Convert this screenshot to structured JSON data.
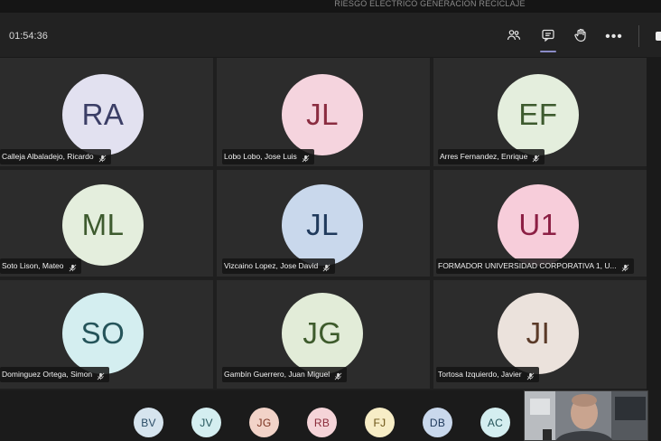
{
  "meeting": {
    "title": "RIESGO ELÉCTRICO GENERACIÓN RECICLAJE",
    "timer": "01:54:36"
  },
  "toolbar": {
    "buttons": [
      {
        "name": "participants-icon"
      },
      {
        "name": "chat-icon",
        "active": true
      },
      {
        "name": "raise-hand-icon"
      },
      {
        "name": "more-options-icon",
        "label": "•••"
      }
    ]
  },
  "participants": [
    {
      "initials": "RA",
      "name": "Calleja Albaladejo, Ricardo",
      "bg": "#e2e1f0",
      "fg": "#3b3e66"
    },
    {
      "initials": "JL",
      "name": "Lobo Lobo, Jose Luis",
      "bg": "#f5d4de",
      "fg": "#8a2c40"
    },
    {
      "initials": "EF",
      "name": "Arres Fernandez, Enrique",
      "bg": "#e4eedd",
      "fg": "#3d5a2e"
    },
    {
      "initials": "ML",
      "name": "Soto Lison, Mateo",
      "bg": "#e4eedd",
      "fg": "#3d5a2e"
    },
    {
      "initials": "JL",
      "name": "Vizcaino Lopez, Jose David",
      "bg": "#c9d8ec",
      "fg": "#203a5c"
    },
    {
      "initials": "U1",
      "name": "FORMADOR UNIVERSIDAD CORPORATIVA 1, U...",
      "bg": "#f7cdda",
      "fg": "#8c1f44"
    },
    {
      "initials": "SO",
      "name": "Dominguez Ortega, Simon",
      "bg": "#d4eef0",
      "fg": "#25545a"
    },
    {
      "initials": "JG",
      "name": "Gambín Guerrero, Juan Miguel",
      "bg": "#e2ecd8",
      "fg": "#3e5b2c"
    },
    {
      "initials": "JI",
      "name": "Tortosa Izquierdo, Javier",
      "bg": "#ebe2dc",
      "fg": "#5a3a28"
    }
  ],
  "overflow_participants": [
    {
      "initials": "BV",
      "bg": "#d6e4ee",
      "fg": "#2a4c66"
    },
    {
      "initials": "JV",
      "bg": "#d4eef0",
      "fg": "#22545a"
    },
    {
      "initials": "JG",
      "bg": "#f2d3c8",
      "fg": "#7a3320"
    },
    {
      "initials": "RB",
      "bg": "#f5d4d8",
      "fg": "#8a2c3a"
    },
    {
      "initials": "FJ",
      "bg": "#f7edc6",
      "fg": "#6a5214"
    },
    {
      "initials": "DB",
      "bg": "#c9d8ec",
      "fg": "#203a5c"
    },
    {
      "initials": "AC",
      "bg": "#d4eef0",
      "fg": "#25545a"
    }
  ]
}
